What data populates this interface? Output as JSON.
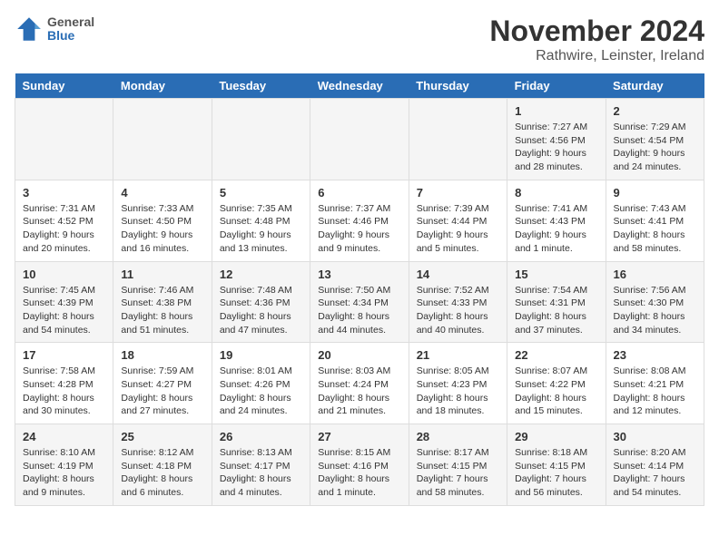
{
  "logo": {
    "line1": "General",
    "line2": "Blue"
  },
  "title": "November 2024",
  "subtitle": "Rathwire, Leinster, Ireland",
  "weekdays": [
    "Sunday",
    "Monday",
    "Tuesday",
    "Wednesday",
    "Thursday",
    "Friday",
    "Saturday"
  ],
  "weeks": [
    [
      {
        "day": "",
        "info": ""
      },
      {
        "day": "",
        "info": ""
      },
      {
        "day": "",
        "info": ""
      },
      {
        "day": "",
        "info": ""
      },
      {
        "day": "",
        "info": ""
      },
      {
        "day": "1",
        "info": "Sunrise: 7:27 AM\nSunset: 4:56 PM\nDaylight: 9 hours\nand 28 minutes."
      },
      {
        "day": "2",
        "info": "Sunrise: 7:29 AM\nSunset: 4:54 PM\nDaylight: 9 hours\nand 24 minutes."
      }
    ],
    [
      {
        "day": "3",
        "info": "Sunrise: 7:31 AM\nSunset: 4:52 PM\nDaylight: 9 hours\nand 20 minutes."
      },
      {
        "day": "4",
        "info": "Sunrise: 7:33 AM\nSunset: 4:50 PM\nDaylight: 9 hours\nand 16 minutes."
      },
      {
        "day": "5",
        "info": "Sunrise: 7:35 AM\nSunset: 4:48 PM\nDaylight: 9 hours\nand 13 minutes."
      },
      {
        "day": "6",
        "info": "Sunrise: 7:37 AM\nSunset: 4:46 PM\nDaylight: 9 hours\nand 9 minutes."
      },
      {
        "day": "7",
        "info": "Sunrise: 7:39 AM\nSunset: 4:44 PM\nDaylight: 9 hours\nand 5 minutes."
      },
      {
        "day": "8",
        "info": "Sunrise: 7:41 AM\nSunset: 4:43 PM\nDaylight: 9 hours\nand 1 minute."
      },
      {
        "day": "9",
        "info": "Sunrise: 7:43 AM\nSunset: 4:41 PM\nDaylight: 8 hours\nand 58 minutes."
      }
    ],
    [
      {
        "day": "10",
        "info": "Sunrise: 7:45 AM\nSunset: 4:39 PM\nDaylight: 8 hours\nand 54 minutes."
      },
      {
        "day": "11",
        "info": "Sunrise: 7:46 AM\nSunset: 4:38 PM\nDaylight: 8 hours\nand 51 minutes."
      },
      {
        "day": "12",
        "info": "Sunrise: 7:48 AM\nSunset: 4:36 PM\nDaylight: 8 hours\nand 47 minutes."
      },
      {
        "day": "13",
        "info": "Sunrise: 7:50 AM\nSunset: 4:34 PM\nDaylight: 8 hours\nand 44 minutes."
      },
      {
        "day": "14",
        "info": "Sunrise: 7:52 AM\nSunset: 4:33 PM\nDaylight: 8 hours\nand 40 minutes."
      },
      {
        "day": "15",
        "info": "Sunrise: 7:54 AM\nSunset: 4:31 PM\nDaylight: 8 hours\nand 37 minutes."
      },
      {
        "day": "16",
        "info": "Sunrise: 7:56 AM\nSunset: 4:30 PM\nDaylight: 8 hours\nand 34 minutes."
      }
    ],
    [
      {
        "day": "17",
        "info": "Sunrise: 7:58 AM\nSunset: 4:28 PM\nDaylight: 8 hours\nand 30 minutes."
      },
      {
        "day": "18",
        "info": "Sunrise: 7:59 AM\nSunset: 4:27 PM\nDaylight: 8 hours\nand 27 minutes."
      },
      {
        "day": "19",
        "info": "Sunrise: 8:01 AM\nSunset: 4:26 PM\nDaylight: 8 hours\nand 24 minutes."
      },
      {
        "day": "20",
        "info": "Sunrise: 8:03 AM\nSunset: 4:24 PM\nDaylight: 8 hours\nand 21 minutes."
      },
      {
        "day": "21",
        "info": "Sunrise: 8:05 AM\nSunset: 4:23 PM\nDaylight: 8 hours\nand 18 minutes."
      },
      {
        "day": "22",
        "info": "Sunrise: 8:07 AM\nSunset: 4:22 PM\nDaylight: 8 hours\nand 15 minutes."
      },
      {
        "day": "23",
        "info": "Sunrise: 8:08 AM\nSunset: 4:21 PM\nDaylight: 8 hours\nand 12 minutes."
      }
    ],
    [
      {
        "day": "24",
        "info": "Sunrise: 8:10 AM\nSunset: 4:19 PM\nDaylight: 8 hours\nand 9 minutes."
      },
      {
        "day": "25",
        "info": "Sunrise: 8:12 AM\nSunset: 4:18 PM\nDaylight: 8 hours\nand 6 minutes."
      },
      {
        "day": "26",
        "info": "Sunrise: 8:13 AM\nSunset: 4:17 PM\nDaylight: 8 hours\nand 4 minutes."
      },
      {
        "day": "27",
        "info": "Sunrise: 8:15 AM\nSunset: 4:16 PM\nDaylight: 8 hours\nand 1 minute."
      },
      {
        "day": "28",
        "info": "Sunrise: 8:17 AM\nSunset: 4:15 PM\nDaylight: 7 hours\nand 58 minutes."
      },
      {
        "day": "29",
        "info": "Sunrise: 8:18 AM\nSunset: 4:15 PM\nDaylight: 7 hours\nand 56 minutes."
      },
      {
        "day": "30",
        "info": "Sunrise: 8:20 AM\nSunset: 4:14 PM\nDaylight: 7 hours\nand 54 minutes."
      }
    ]
  ]
}
